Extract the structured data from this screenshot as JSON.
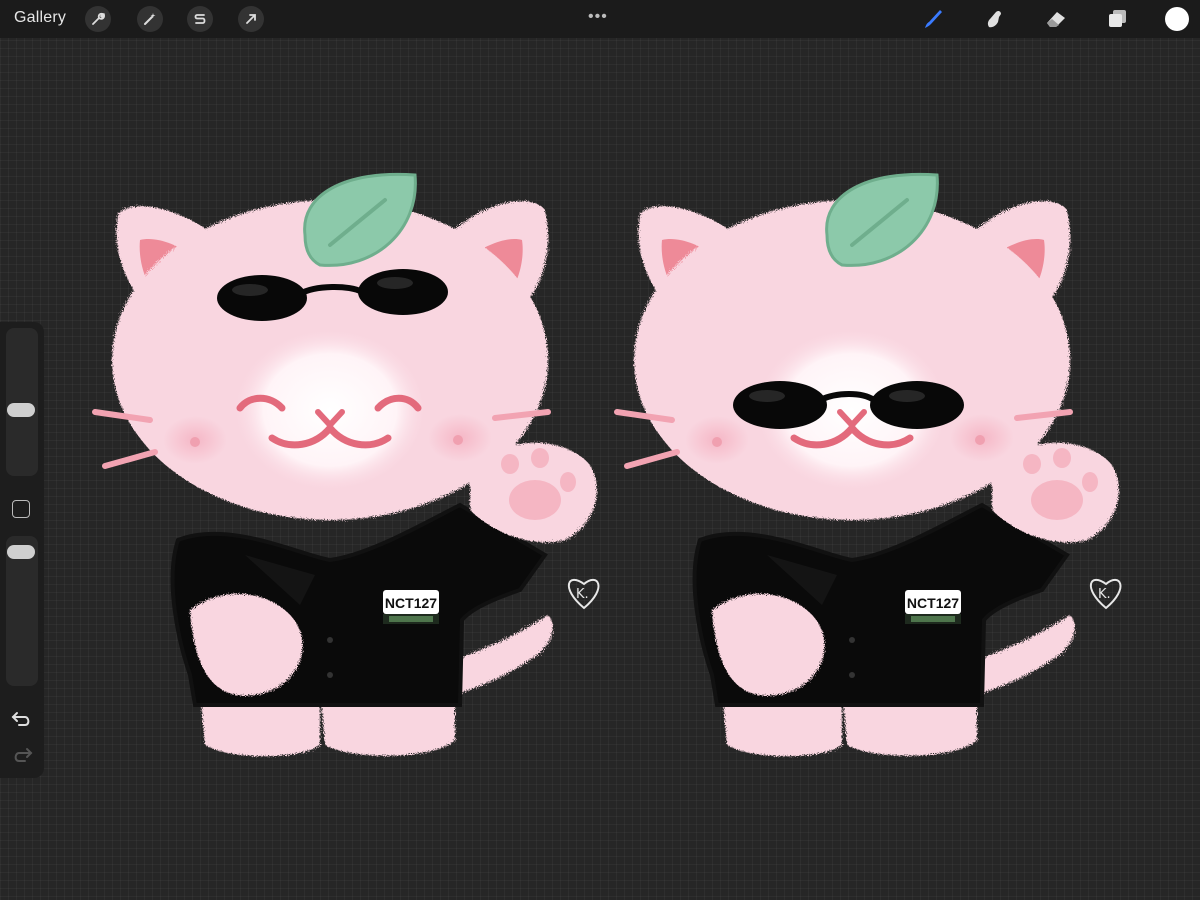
{
  "toolbar": {
    "gallery_label": "Gallery",
    "left_tools": [
      "wrench-icon",
      "magic-wand-icon",
      "selection-s-icon",
      "move-arrow-icon"
    ],
    "more_label": "•••",
    "right_tools": [
      "brush-icon",
      "smudge-icon",
      "eraser-icon",
      "layers-icon"
    ],
    "active_tool": "brush-icon",
    "current_color": "#ffffff",
    "accent_color": "#3a7bff"
  },
  "sidebar": {
    "tools": [
      "brush-size-slider",
      "modify-square-button",
      "opacity-slider",
      "undo-icon",
      "redo-icon"
    ]
  },
  "artwork": {
    "badge_text_left": "NCT127",
    "badge_text_right": "NCT127",
    "signature_left": "K.",
    "signature_right": "K.",
    "colors": {
      "fur": "#f9d6e0",
      "ear_inner": "#ee8a98",
      "leaf": "#8cc9aa",
      "shirt": "#0a0a0a",
      "glasses": "#080808",
      "mouth": "#e36a7c"
    }
  }
}
